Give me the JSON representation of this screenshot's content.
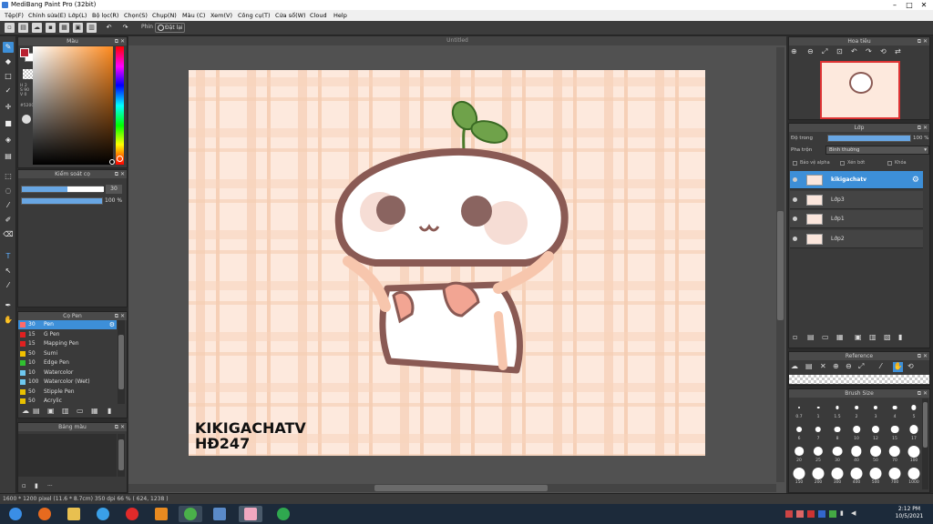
{
  "window": {
    "title": "MediBang Paint Pro (32bit)",
    "minimize": "–",
    "maximize": "□",
    "close": "✕"
  },
  "menu": [
    "Tệp(F)",
    "Chỉnh sửa(E)",
    "Lớp(L)",
    "Bộ lọc(R)",
    "Chọn(S)",
    "Chụp(N)",
    "Màu (C)",
    "Xem(V)",
    "Công cụ(T)",
    "Cửa sổ(W)",
    "Cloud",
    "Help"
  ],
  "toolbar": {
    "pen_label": "Phin",
    "stabilizer_label": "Đặt lại"
  },
  "document_tab": "Untitled",
  "color_panel": {
    "title": "Màu",
    "primary_color": "#b82030",
    "secondary_color": "#ffffff",
    "hex_value": "#520000",
    "hsv_values": [
      "H 2",
      "S 90",
      "V 0"
    ]
  },
  "brush_control": {
    "title": "Kiểm soát cọ",
    "size": "30",
    "size_fraction": 0.6,
    "opacity": "100 %",
    "opacity_fraction": 1.0
  },
  "pen_panel": {
    "title": "Cọ Pen",
    "pens": [
      {
        "size": "30",
        "name": "Pen",
        "color": "#ff6a6a"
      },
      {
        "size": "15",
        "name": "G Pen",
        "color": "#e02020"
      },
      {
        "size": "15",
        "name": "Mapping Pen",
        "color": "#e02020"
      },
      {
        "size": "50",
        "name": "Sumi",
        "color": "#f0c000"
      },
      {
        "size": "10",
        "name": "Edge Pen",
        "color": "#30c030"
      },
      {
        "size": "10",
        "name": "Watercolor",
        "color": "#6ec8f0"
      },
      {
        "size": "100",
        "name": "Watercolor (Wet)",
        "color": "#6ec8f0"
      },
      {
        "size": "50",
        "name": "Stipple Pen",
        "color": "#e8c000"
      },
      {
        "size": "50",
        "name": "Acrylic",
        "color": "#e8c000"
      }
    ]
  },
  "mixer_panel": {
    "title": "Bảng màu",
    "footer": "---"
  },
  "navigator": {
    "title": "Hoa tiêu"
  },
  "layer_panel": {
    "title": "Lớp",
    "opacity_label": "Độ trong",
    "opacity_value": "100 %",
    "opacity_fraction": 1.0,
    "blend_label": "Pha trộn",
    "blend_value": "Bình thường",
    "protect_alpha": "Bảo vệ alpha",
    "clipping": "Xén bớt",
    "lock": "Khóa",
    "layers": [
      {
        "name": "kikigachatv",
        "selected": true
      },
      {
        "name": "Lớp3",
        "selected": false
      },
      {
        "name": "Lớp1",
        "selected": false
      },
      {
        "name": "Lớp2",
        "selected": false
      }
    ]
  },
  "reference_panel": {
    "title": "Reference"
  },
  "brush_size_panel": {
    "title": "Brush Size",
    "sizes": [
      "0.7",
      "1",
      "1.5",
      "2",
      "3",
      "4",
      "5",
      "6",
      "7",
      "8",
      "10",
      "12",
      "15",
      "17",
      "20",
      "25",
      "30",
      "40",
      "50",
      "70",
      "100",
      "150",
      "200",
      "300",
      "400",
      "500",
      "700",
      "1000"
    ]
  },
  "canvas_text": {
    "watermark_line1": "KIKIGACHATV",
    "watermark_line2": "HĐ247"
  },
  "status_bar": "1600 * 1200 pixel  (11.6 * 8.7cm)  350 dpi  66 %  ( 624, 1238 )",
  "taskbar": {
    "time": "2:12 PM",
    "date": "10/5/2021"
  }
}
